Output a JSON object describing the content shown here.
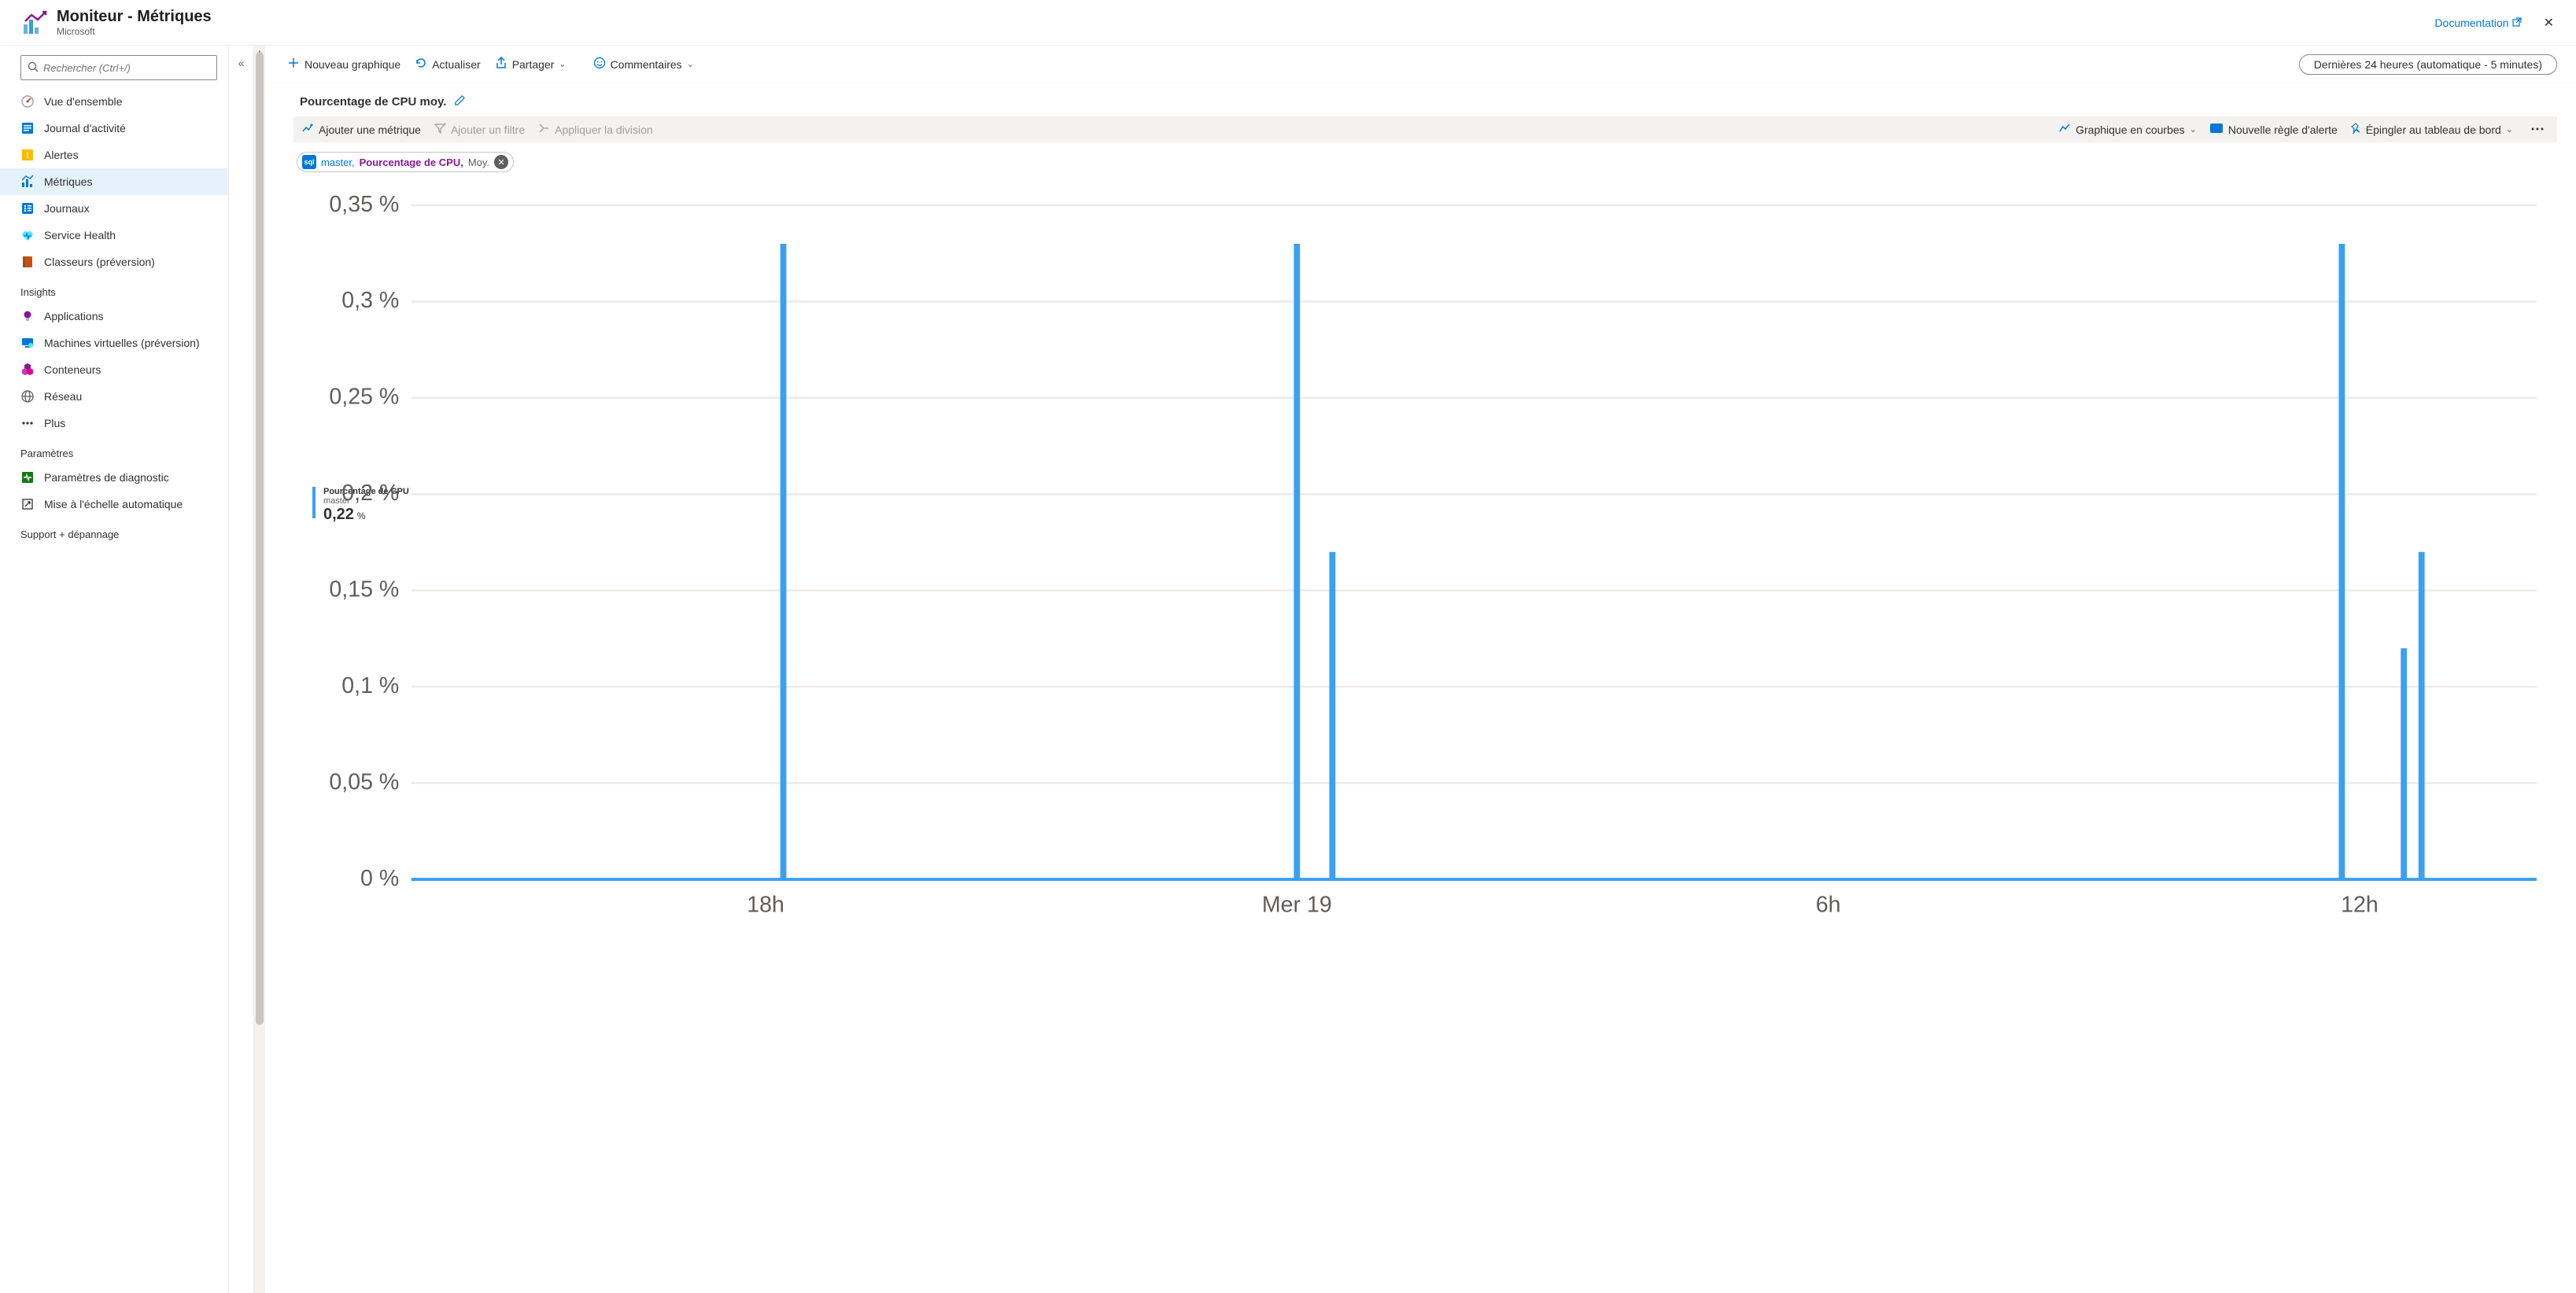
{
  "header": {
    "title": "Moniteur - Métriques",
    "subtitle": "Microsoft",
    "doc_link": "Documentation"
  },
  "search": {
    "placeholder": "Rechercher (Ctrl+/)"
  },
  "sidebar": {
    "groups": [
      {
        "label": null,
        "items": [
          {
            "label": "Vue d'ensemble",
            "icon": "gauge"
          },
          {
            "label": "Journal d'activité",
            "icon": "activity"
          },
          {
            "label": "Alertes",
            "icon": "alert"
          },
          {
            "label": "Métriques",
            "icon": "metrics",
            "active": true
          },
          {
            "label": "Journaux",
            "icon": "logs"
          },
          {
            "label": "Service Health",
            "icon": "health"
          },
          {
            "label": "Classeurs (préversion)",
            "icon": "workbook"
          }
        ]
      },
      {
        "label": "Insights",
        "items": [
          {
            "label": "Applications",
            "icon": "bulb"
          },
          {
            "label": "Machines virtuelles (préversion)",
            "icon": "vm"
          },
          {
            "label": "Conteneurs",
            "icon": "containers"
          },
          {
            "label": "Réseau",
            "icon": "network"
          },
          {
            "label": "Plus",
            "icon": "more"
          }
        ]
      },
      {
        "label": "Paramètres",
        "items": [
          {
            "label": "Paramètres de diagnostic",
            "icon": "diag"
          },
          {
            "label": "Mise à l'échelle automatique",
            "icon": "autoscale"
          }
        ]
      },
      {
        "label": "Support + dépannage",
        "items": []
      }
    ]
  },
  "toolbar": {
    "new_chart": "Nouveau graphique",
    "refresh": "Actualiser",
    "share": "Partager",
    "feedback": "Commentaires",
    "time_range": "Dernières 24 heures (automatique - 5 minutes)"
  },
  "chart": {
    "title": "Pourcentage de CPU moy.",
    "toolbar": {
      "add_metric": "Ajouter une métrique",
      "add_filter": "Ajouter un filtre",
      "apply_split": "Appliquer la division",
      "chart_type": "Graphique en courbes",
      "new_alert": "Nouvelle règle d'alerte",
      "pin": "Épingler au tableau de bord"
    },
    "metric_pill": {
      "resource": "master,",
      "metric": "Pourcentage de CPU,",
      "agg": "Moy."
    },
    "legend": {
      "title": "Pourcentage de CPU",
      "resource": "master",
      "value": "0,22",
      "unit": "%"
    }
  },
  "chart_data": {
    "type": "line",
    "title": "Pourcentage de CPU moy.",
    "xlabel": "",
    "ylabel": "",
    "ylim": [
      0,
      0.35
    ],
    "y_ticks": [
      "0 %",
      "0,05 %",
      "0,1 %",
      "0,15 %",
      "0,2 %",
      "0,25 %",
      "0,3 %",
      "0,35 %"
    ],
    "x_ticks": [
      "18h",
      "Mer 19",
      "6h",
      "12h"
    ],
    "x_range_hours": [
      14,
      14.5
    ],
    "series": [
      {
        "name": "Pourcentage de CPU (master, Moy.)",
        "baseline": 0,
        "spikes": [
          {
            "x_hour_offset": 4.2,
            "value": 0.33
          },
          {
            "x_hour_offset": 10.0,
            "value": 0.33
          },
          {
            "x_hour_offset": 10.4,
            "value": 0.17
          },
          {
            "x_hour_offset": 21.8,
            "value": 0.33
          },
          {
            "x_hour_offset": 22.5,
            "value": 0.12
          },
          {
            "x_hour_offset": 22.7,
            "value": 0.17
          }
        ]
      }
    ]
  }
}
